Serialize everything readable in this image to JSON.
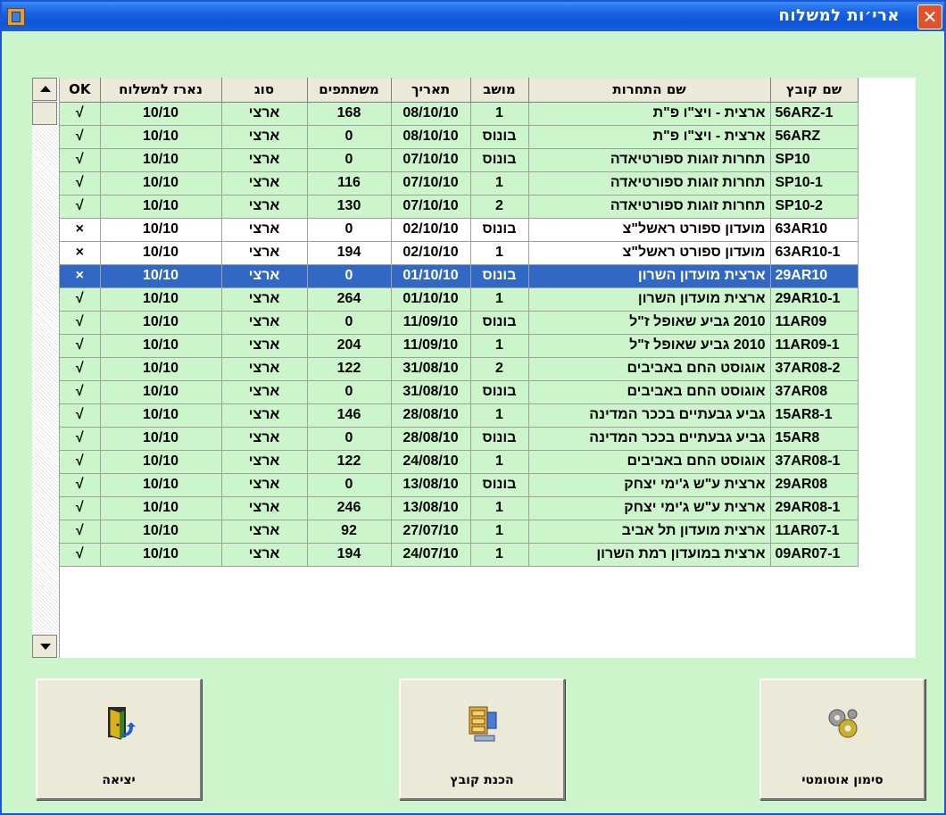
{
  "window": {
    "title": "ארי׳ות למשלוח",
    "close_label": "✕"
  },
  "columns": {
    "ok": "OK",
    "sent_date": "נארז למשלוח",
    "type": "סוג",
    "participants": "משתתפים",
    "date": "תאריך",
    "session": "מושב",
    "competition": "שם התחרות",
    "file": "שם קובץ"
  },
  "rows": [
    {
      "ok": "√",
      "sent": "10/10",
      "type": "ארצי",
      "participants": "168",
      "date": "08/10/10",
      "session": "1",
      "competition": "ארצית - ויצ\"ו פ\"ת",
      "file": "56ARZ-1",
      "style": "row"
    },
    {
      "ok": "√",
      "sent": "10/10",
      "type": "ארצי",
      "participants": "0",
      "date": "08/10/10",
      "session": "בונוס",
      "competition": "ארצית - ויצ\"ו פ\"ת",
      "file": "56ARZ",
      "style": "row"
    },
    {
      "ok": "√",
      "sent": "10/10",
      "type": "ארצי",
      "participants": "0",
      "date": "07/10/10",
      "session": "בונוס",
      "competition": "תחרות זוגות ספורטיאדה",
      "file": "SP10",
      "style": "row"
    },
    {
      "ok": "√",
      "sent": "10/10",
      "type": "ארצי",
      "participants": "116",
      "date": "07/10/10",
      "session": "1",
      "competition": "תחרות זוגות ספורטיאדה",
      "file": "SP10-1",
      "style": "row"
    },
    {
      "ok": "√",
      "sent": "10/10",
      "type": "ארצי",
      "participants": "130",
      "date": "07/10/10",
      "session": "2",
      "competition": "תחרות זוגות ספורטיאדה",
      "file": "SP10-2",
      "style": "row"
    },
    {
      "ok": "×",
      "sent": "10/10",
      "type": "ארצי",
      "participants": "0",
      "date": "02/10/10",
      "session": "בונוס",
      "competition": "מועדון ספורט ראשל\"צ",
      "file": "63AR10",
      "style": "white"
    },
    {
      "ok": "×",
      "sent": "10/10",
      "type": "ארצי",
      "participants": "194",
      "date": "02/10/10",
      "session": "1",
      "competition": "מועדון ספורט ראשל\"צ",
      "file": "63AR10-1",
      "style": "white"
    },
    {
      "ok": "×",
      "sent": "10/10",
      "type": "ארצי",
      "participants": "0",
      "date": "01/10/10",
      "session": "בונוס",
      "competition": "ארצית מועדון השרון",
      "file": "29AR10",
      "style": "sel"
    },
    {
      "ok": "√",
      "sent": "10/10",
      "type": "ארצי",
      "participants": "264",
      "date": "01/10/10",
      "session": "1",
      "competition": "ארצית מועדון השרון",
      "file": "29AR10-1",
      "style": "row"
    },
    {
      "ok": "√",
      "sent": "10/10",
      "type": "ארצי",
      "participants": "0",
      "date": "11/09/10",
      "session": "בונוס",
      "competition": "2010 גביע שאופל ז\"ל",
      "file": "11AR09",
      "style": "row"
    },
    {
      "ok": "√",
      "sent": "10/10",
      "type": "ארצי",
      "participants": "204",
      "date": "11/09/10",
      "session": "1",
      "competition": "2010 גביע שאופל ז\"ל",
      "file": "11AR09-1",
      "style": "row"
    },
    {
      "ok": "√",
      "sent": "10/10",
      "type": "ארצי",
      "participants": "122",
      "date": "31/08/10",
      "session": "2",
      "competition": "אוגוסט החם באביבים",
      "file": "37AR08-2",
      "style": "row"
    },
    {
      "ok": "√",
      "sent": "10/10",
      "type": "ארצי",
      "participants": "0",
      "date": "31/08/10",
      "session": "בונוס",
      "competition": "אוגוסט החם באביבים",
      "file": "37AR08",
      "style": "row"
    },
    {
      "ok": "√",
      "sent": "10/10",
      "type": "ארצי",
      "participants": "146",
      "date": "28/08/10",
      "session": "1",
      "competition": "גביע גבעתיים בככר המדינה",
      "file": "15AR8-1",
      "style": "row"
    },
    {
      "ok": "√",
      "sent": "10/10",
      "type": "ארצי",
      "participants": "0",
      "date": "28/08/10",
      "session": "בונוס",
      "competition": "גביע גבעתיים בככר המדינה",
      "file": "15AR8",
      "style": "row"
    },
    {
      "ok": "√",
      "sent": "10/10",
      "type": "ארצי",
      "participants": "122",
      "date": "24/08/10",
      "session": "1",
      "competition": "אוגוסט החם באביבים",
      "file": "37AR08-1",
      "style": "row"
    },
    {
      "ok": "√",
      "sent": "10/10",
      "type": "ארצי",
      "participants": "0",
      "date": "13/08/10",
      "session": "בונוס",
      "competition": "ארצית ע\"ש ג'ימי יצחק",
      "file": "29AR08",
      "style": "row"
    },
    {
      "ok": "√",
      "sent": "10/10",
      "type": "ארצי",
      "participants": "246",
      "date": "13/08/10",
      "session": "1",
      "competition": "ארצית ע\"ש ג'ימי יצחק",
      "file": "29AR08-1",
      "style": "row"
    },
    {
      "ok": "√",
      "sent": "10/10",
      "type": "ארצי",
      "participants": "92",
      "date": "27/07/10",
      "session": "1",
      "competition": "ארצית מועדון תל אביב",
      "file": "11AR07-1",
      "style": "row"
    },
    {
      "ok": "√",
      "sent": "10/10",
      "type": "ארצי",
      "participants": "194",
      "date": "24/07/10",
      "session": "1",
      "competition": "ארצית במועדון רמת השרון",
      "file": "09AR07-1",
      "style": "row"
    }
  ],
  "buttons": {
    "exit": "יציאה",
    "prepare_file": "הכנת קובץ",
    "auto_mark": "סימון אוטומטי"
  },
  "colors": {
    "background": "#ccf5cc",
    "selected": "#3168c5",
    "titlebar": "#0d54d8"
  }
}
